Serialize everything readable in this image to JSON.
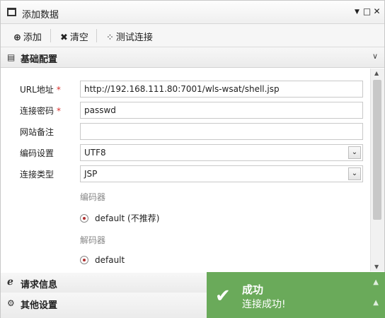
{
  "window": {
    "title": "添加数据",
    "minimize_glyph": "▼",
    "maximize_glyph": "□",
    "close_glyph": "✕"
  },
  "toolbar": {
    "add_label": "添加",
    "clear_label": "清空",
    "test_label": "测试连接"
  },
  "sections": {
    "basic": {
      "label": "基础配置",
      "icon": "list-icon",
      "chevron": "∨"
    },
    "request": {
      "label": "请求信息",
      "icon": "ie-icon"
    },
    "other": {
      "label": "其他设置",
      "icon": "gears-icon"
    }
  },
  "form": {
    "url": {
      "label": "URL地址",
      "required_mark": "*",
      "value": "http://192.168.111.80:7001/wls-wsat/shell.jsp"
    },
    "password": {
      "label": "连接密码",
      "required_mark": "*",
      "value": "passwd"
    },
    "note": {
      "label": "网站备注",
      "value": ""
    },
    "encoding": {
      "label": "编码设置",
      "value": "UTF8"
    },
    "conn_type": {
      "label": "连接类型",
      "value": "JSP"
    },
    "encoder": {
      "label": "编码器",
      "option": "default (不推荐)"
    },
    "decoder": {
      "label": "解码器",
      "option": "default"
    }
  },
  "toast": {
    "title": "成功",
    "message": "连接成功!",
    "color": "#6aaa5a"
  },
  "colors": {
    "required": "#d9302c",
    "radio_selected": "#b03030"
  }
}
